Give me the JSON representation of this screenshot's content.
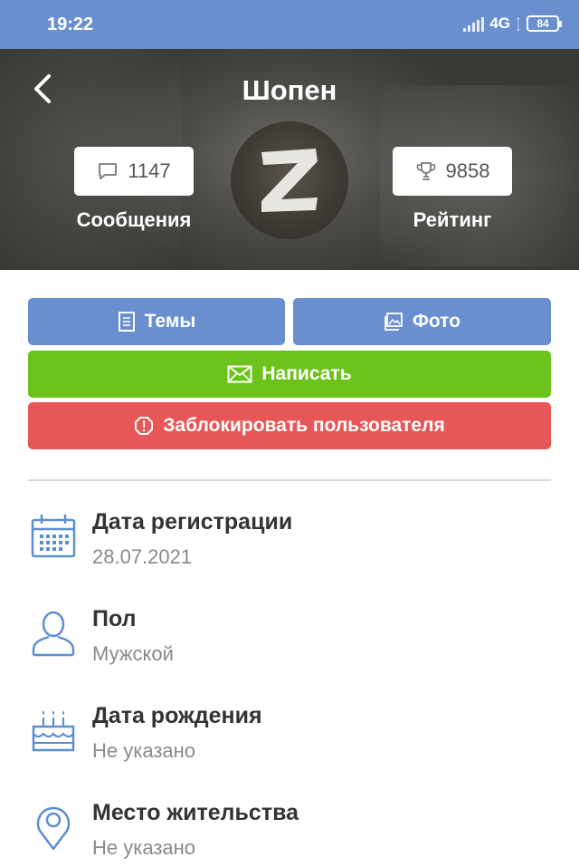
{
  "status_bar": {
    "time": "19:22",
    "network": "4G",
    "battery": "84"
  },
  "header": {
    "title": "Шопен",
    "messages": {
      "count": "1147",
      "label": "Сообщения"
    },
    "rating": {
      "count": "9858",
      "label": "Рейтинг"
    },
    "avatar_letter": "Z"
  },
  "actions": {
    "topics": "Темы",
    "photo": "Фото",
    "write": "Написать",
    "block": "Заблокировать пользователя"
  },
  "info": [
    {
      "label": "Дата регистрации",
      "value": "28.07.2021",
      "icon": "calendar-icon"
    },
    {
      "label": "Пол",
      "value": "Мужской",
      "icon": "user-icon"
    },
    {
      "label": "Дата рождения",
      "value": "Не указано",
      "icon": "birthday-cake-icon"
    },
    {
      "label": "Место жительства",
      "value": "Не указано",
      "icon": "location-pin-icon"
    }
  ],
  "colors": {
    "accent": "#6a8fcf",
    "write": "#6cc31d",
    "block": "#e85757",
    "icon": "#5b8fd0"
  }
}
